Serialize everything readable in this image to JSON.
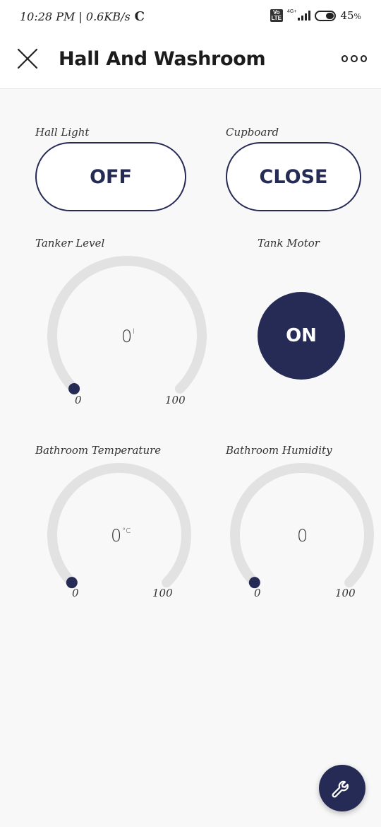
{
  "status_bar": {
    "time_speed": "10:28 PM | 0.6KB/s",
    "sync_icon": "C",
    "volte_top": "Vo",
    "volte_bottom": "LTE",
    "network": "4G+",
    "battery_pct": "45",
    "battery_unit": "%"
  },
  "header": {
    "title": "Hall And Washroom",
    "close_icon": "close-icon",
    "more_icon": "more-icon"
  },
  "widgets": {
    "hall_light": {
      "label": "Hall Light",
      "state": "OFF"
    },
    "cupboard": {
      "label": "Cupboard",
      "state": "CLOSE"
    },
    "tanker_level": {
      "label": "Tanker Level",
      "value": "0",
      "unit": "l",
      "min": "0",
      "max": "100",
      "fraction": 0
    },
    "tank_motor": {
      "label": "Tank Motor",
      "state": "ON"
    },
    "bathroom_temperature": {
      "label": "Bathroom Temperature",
      "value": "0",
      "unit": "°C",
      "min": "0",
      "max": "100",
      "fraction": 0
    },
    "bathroom_humidity": {
      "label": "Bathroom Humidity",
      "value": "0",
      "unit": "",
      "min": "0",
      "max": "100",
      "fraction": 0
    }
  },
  "fab": {
    "icon": "wrench-icon"
  },
  "colors": {
    "accent": "#262b55",
    "track": "#e2e2e2",
    "background": "#f8f8f8"
  }
}
